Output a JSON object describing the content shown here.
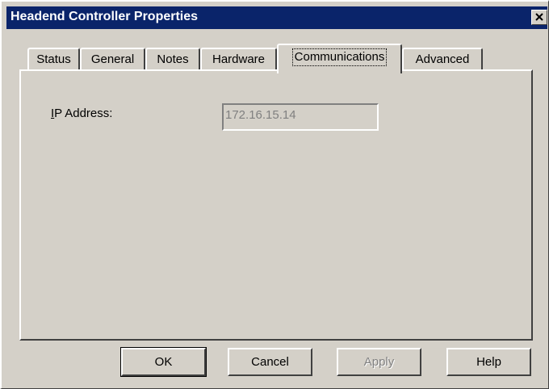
{
  "window": {
    "title": "Headend Controller Properties"
  },
  "tabs": [
    {
      "label": "Status",
      "active": false
    },
    {
      "label": "General",
      "active": false
    },
    {
      "label": "Notes",
      "active": false
    },
    {
      "label": "Hardware",
      "active": false
    },
    {
      "label": "Communications",
      "active": true
    },
    {
      "label": "Advanced",
      "active": false
    }
  ],
  "communications": {
    "ip_label": "IP Address:",
    "ip_value": "172.16.15.14"
  },
  "buttons": {
    "ok": "OK",
    "cancel": "Cancel",
    "apply": "Apply",
    "help": "Help"
  },
  "colors": {
    "titlebar": "#0a246a",
    "face": "#d4d0c8",
    "disabled_text": "#808080"
  }
}
